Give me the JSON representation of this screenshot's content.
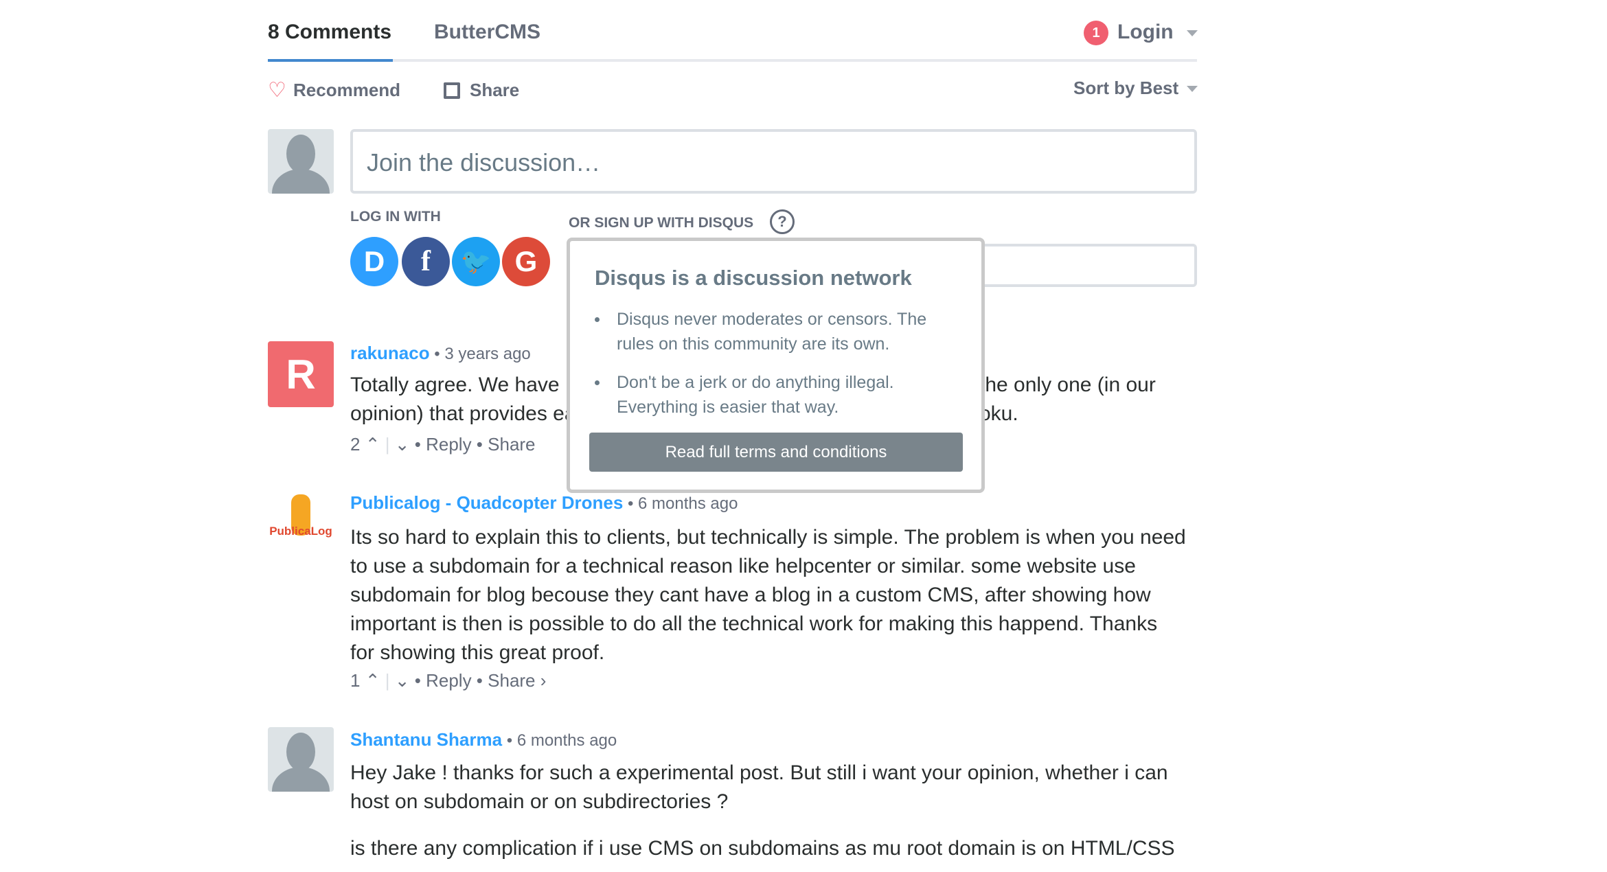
{
  "tabs": {
    "comments": "8 Comments",
    "community": "ButterCMS",
    "login": "Login",
    "notif_count": "1"
  },
  "actions": {
    "recommend": "Recommend",
    "share": "Share",
    "sort": "Sort by Best"
  },
  "composer": {
    "placeholder": "Join the discussion…",
    "log_in_with": "LOG IN WITH",
    "sign_up": "OR SIGN UP WITH DISQUS",
    "social": [
      "D",
      "f",
      "t",
      "G"
    ]
  },
  "popup": {
    "title": "Disqus is a discussion network",
    "bullets": [
      "Disqus never moderates or censors. The rules on this community are its own.",
      "Don't be a jerk or do anything illegal. Everything is easier that way."
    ],
    "button": "Read full terms and conditions"
  },
  "comments": [
    {
      "author": "rakunaco",
      "time": "3 years ago",
      "lines_left": [
        "Totally agree. We have r",
        "opinion) that provides ea"
      ],
      "lines_right": [
        "the only one (in our",
        "oku."
      ],
      "votes": "2",
      "reply": "Reply",
      "share": "Share"
    },
    {
      "author": "Publicalog - Quadcopter Drones",
      "time": "6 months ago",
      "lines": [
        "Its so hard to explain this to clients, but technically is simple. The problem is when you need",
        "to use a subdomain for a technical reason like helpcenter or similar. some website use",
        "subdomain for blog becouse they cant have a blog in a custom CMS, after showing how",
        "important is then is possible to do all the technical work for making this happend. Thanks",
        "for showing this great proof."
      ],
      "votes": "1",
      "reply": "Reply",
      "share": "Share ›",
      "avatar_text": "PublicaLog"
    },
    {
      "author": "Shantanu Sharma",
      "time": "6 months ago",
      "lines": [
        "Hey Jake ! thanks for such a experimental post. But still i want your opinion, whether i can",
        "host on subdomain or on subdirectories ?"
      ],
      "para2": "is there any complication if i use CMS on subdomains as mu root domain is on HTML/CSS"
    }
  ],
  "colors": {
    "accent": "#2e9fff",
    "tab_underline": "#4288ce",
    "badge": "#f05f70"
  }
}
